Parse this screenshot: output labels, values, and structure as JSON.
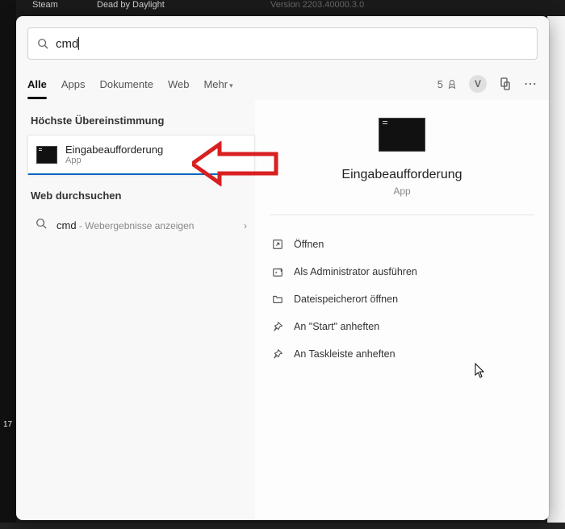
{
  "background": {
    "app1": "Steam",
    "app2": "Dead by Daylight",
    "version": "Version 2203.40000.3.0",
    "left_label": "17"
  },
  "search": {
    "query": "cmd",
    "placeholder": ""
  },
  "tabs": {
    "items": [
      {
        "label": "Alle",
        "active": true
      },
      {
        "label": "Apps",
        "active": false
      },
      {
        "label": "Dokumente",
        "active": false
      },
      {
        "label": "Web",
        "active": false
      }
    ],
    "more_label": "Mehr"
  },
  "header_right": {
    "points": "5",
    "avatar_initial": "V"
  },
  "left": {
    "best_match_header": "Höchste Übereinstimmung",
    "best_match": {
      "title": "Eingabeaufforderung",
      "subtitle": "App"
    },
    "web_header": "Web durchsuchen",
    "web_item": {
      "query": "cmd",
      "subtitle": " - Webergebnisse anzeigen"
    }
  },
  "preview": {
    "title": "Eingabeaufforderung",
    "type": "App",
    "actions": [
      {
        "icon": "open-icon",
        "label": "Öffnen"
      },
      {
        "icon": "shield-icon",
        "label": "Als Administrator ausführen"
      },
      {
        "icon": "folder-icon",
        "label": "Dateispeicherort öffnen"
      },
      {
        "icon": "pin-icon",
        "label": "An \"Start\" anheften"
      },
      {
        "icon": "pin-icon",
        "label": "An Taskleiste anheften"
      }
    ]
  }
}
